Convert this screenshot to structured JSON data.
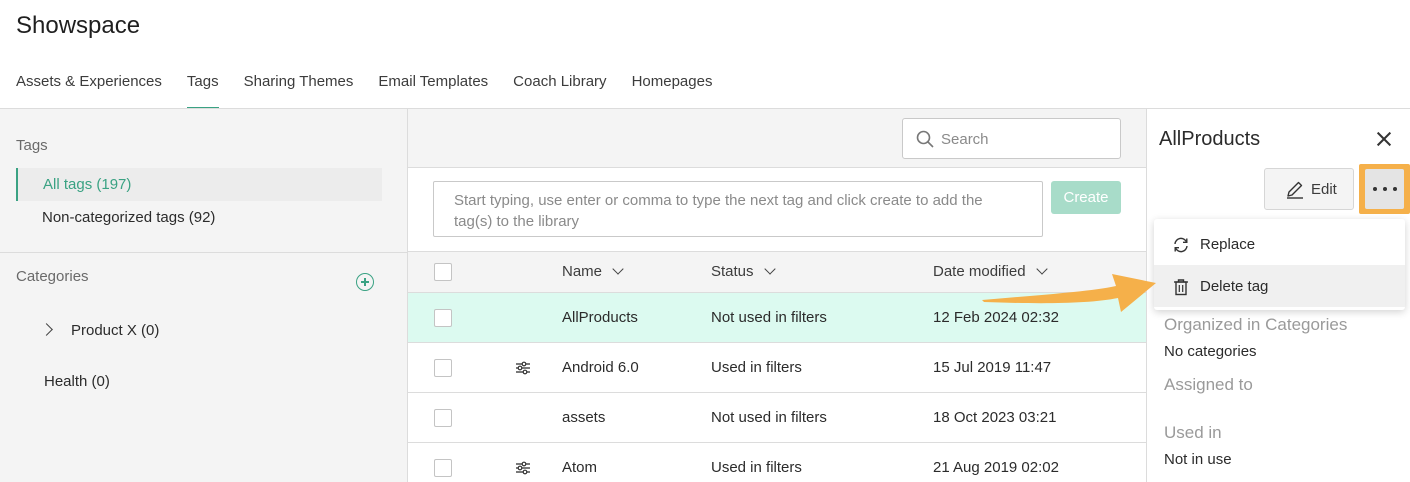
{
  "app": {
    "title": "Showspace"
  },
  "nav": {
    "tabs": [
      {
        "label": "Assets & Experiences",
        "active": false
      },
      {
        "label": "Tags",
        "active": true
      },
      {
        "label": "Sharing Themes",
        "active": false
      },
      {
        "label": "Email Templates",
        "active": false
      },
      {
        "label": "Coach Library",
        "active": false
      },
      {
        "label": "Homepages",
        "active": false
      }
    ]
  },
  "sidebar": {
    "tags_title": "Tags",
    "all_tags": "All tags (197)",
    "non_categorized": "Non-categorized tags (92)",
    "categories_title": "Categories",
    "categories": [
      {
        "label": "Product X (0)",
        "expandable": true
      },
      {
        "label": "Health (0)",
        "expandable": false
      }
    ]
  },
  "toolbar": {
    "search_placeholder": "Search",
    "tag_input_placeholder": "Start typing, use enter or comma to type the next tag and click create to add the tag(s) to the library",
    "create_label": "Create"
  },
  "table": {
    "columns": {
      "name": "Name",
      "status": "Status",
      "date": "Date modified"
    },
    "rows": [
      {
        "name": "AllProducts",
        "status": "Not used in filters",
        "date": "12 Feb 2024 02:32",
        "filter_icon": false,
        "selected": true
      },
      {
        "name": "Android 6.0",
        "status": "Used in filters",
        "date": "15 Jul 2019 11:47",
        "filter_icon": true,
        "selected": false
      },
      {
        "name": "assets",
        "status": "Not used in filters",
        "date": "18 Oct 2023 03:21",
        "filter_icon": false,
        "selected": false
      },
      {
        "name": "Atom",
        "status": "Used in filters",
        "date": "21 Aug 2019 02:02",
        "filter_icon": true,
        "selected": false
      }
    ]
  },
  "panel": {
    "title": "AllProducts",
    "edit_label": "Edit",
    "menu": {
      "replace": "Replace",
      "delete": "Delete tag"
    },
    "organized_label": "Organized in Categories",
    "organized_value": "No categories",
    "assigned_label": "Assigned to",
    "used_in_label": "Used in",
    "used_in_value": "Not in use"
  },
  "colors": {
    "accent": "#3aa283",
    "selected_row": "#dcfaf0",
    "create_disabled": "#a8dcc9",
    "highlight": "#f5b04a"
  }
}
